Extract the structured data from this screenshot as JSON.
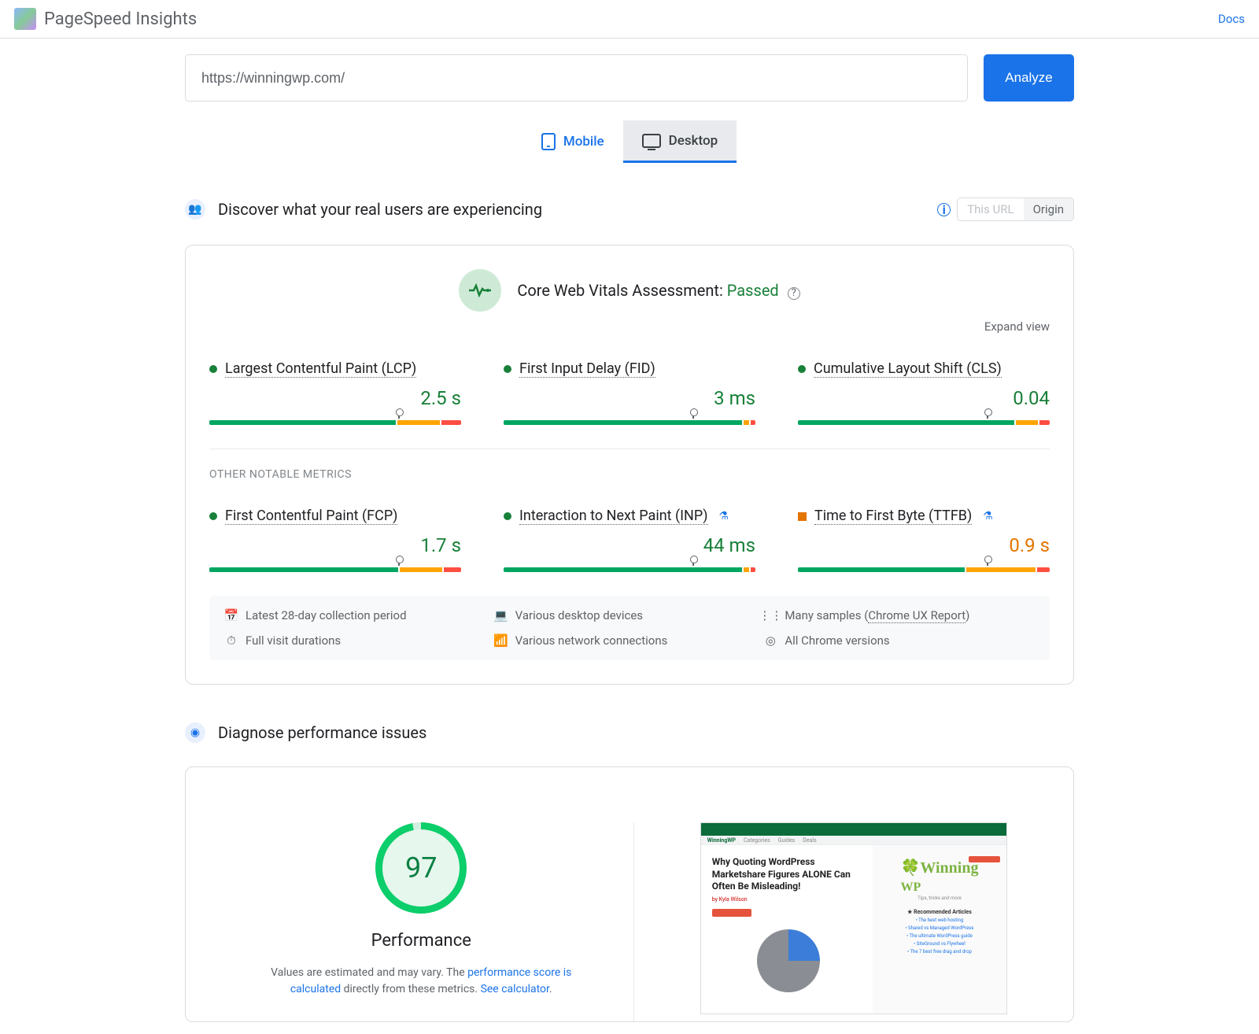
{
  "header": {
    "brand": "PageSpeed Insights",
    "docs": "Docs"
  },
  "url_input": {
    "value": "https://winningwp.com/"
  },
  "analyze_button": "Analyze",
  "tabs": {
    "mobile": "Mobile",
    "desktop": "Desktop"
  },
  "section_discover": {
    "title": "Discover what your real users are experiencing",
    "seg_this_url": "This URL",
    "seg_origin": "Origin"
  },
  "cwv": {
    "label": "Core Web Vitals Assessment: ",
    "status": "Passed",
    "expand": "Expand view"
  },
  "metrics": {
    "lcp": {
      "name": "Largest Contentful Paint (LCP)",
      "value": "2.5 s",
      "bar": {
        "g": 75,
        "o": 17,
        "r": 8
      },
      "marker": 75
    },
    "fid": {
      "name": "First Input Delay (FID)",
      "value": "3 ms",
      "bar": {
        "g": 96,
        "o": 2,
        "r": 2
      },
      "marker": 75
    },
    "cls": {
      "name": "Cumulative Layout Shift (CLS)",
      "value": "0.04",
      "bar": {
        "g": 87,
        "o": 9,
        "r": 4
      },
      "marker": 75
    },
    "other_label": "OTHER NOTABLE METRICS",
    "fcp": {
      "name": "First Contentful Paint (FCP)",
      "value": "1.7 s",
      "bar": {
        "g": 76,
        "o": 17,
        "r": 7
      },
      "marker": 75
    },
    "inp": {
      "name": "Interaction to Next Paint (INP)",
      "value": "44 ms",
      "bar": {
        "g": 96,
        "o": 2,
        "r": 2
      },
      "marker": 75
    },
    "ttfb": {
      "name": "Time to First Byte (TTFB)",
      "value": "0.9 s",
      "bar": {
        "g": 67,
        "o": 28,
        "r": 5
      },
      "marker": 75
    }
  },
  "info": {
    "period": "Latest 28-day collection period",
    "devices": "Various desktop devices",
    "samples_prefix": "Many samples (",
    "samples_link": "Chrome UX Report",
    "samples_suffix": ")",
    "visits": "Full visit durations",
    "network": "Various network connections",
    "chrome": "All Chrome versions"
  },
  "section_diagnose": {
    "title": "Diagnose performance issues"
  },
  "performance": {
    "score": "97",
    "label": "Performance",
    "note_1": "Values are estimated and may vary. The ",
    "note_link1": "performance score is calculated",
    "note_2": " directly from these metrics. ",
    "note_link2": "See calculator",
    "note_3": "."
  },
  "preview": {
    "headline": "Why Quoting WordPress Marketshare Figures ALONE Can Often Be Misleading!",
    "byline": "by Kyla Wilson",
    "nav1": "Categories",
    "nav2": "Guides",
    "nav3": "Deals",
    "logo": "WinningWP",
    "reco": "★ Recommended Articles"
  }
}
